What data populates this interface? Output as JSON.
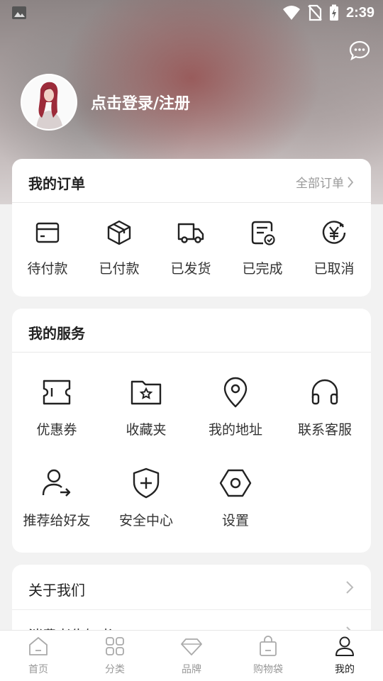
{
  "status_bar": {
    "time": "2:39"
  },
  "profile": {
    "login_label": "点击登录/注册"
  },
  "orders": {
    "title": "我的订单",
    "all_label": "全部订单",
    "items": [
      {
        "label": "待付款",
        "icon": "wallet-card-icon"
      },
      {
        "label": "已付款",
        "icon": "package-box-icon"
      },
      {
        "label": "已发货",
        "icon": "delivery-truck-icon"
      },
      {
        "label": "已完成",
        "icon": "completed-order-icon"
      },
      {
        "label": "已取消",
        "icon": "cancel-yen-icon"
      }
    ]
  },
  "services": {
    "title": "我的服务",
    "items": [
      {
        "label": "优惠券",
        "icon": "coupon-ticket-icon"
      },
      {
        "label": "收藏夹",
        "icon": "star-folder-icon"
      },
      {
        "label": "我的地址",
        "icon": "location-pin-icon"
      },
      {
        "label": "联系客服",
        "icon": "headphones-icon"
      },
      {
        "label": "推荐给好友",
        "icon": "share-user-icon"
      },
      {
        "label": "安全中心",
        "icon": "shield-plus-icon"
      },
      {
        "label": "设置",
        "icon": "hexagon-gear-icon"
      }
    ]
  },
  "about": {
    "rows": [
      {
        "label": "关于我们"
      },
      {
        "label": "消费者告知书"
      }
    ]
  },
  "tabbar": {
    "active_index": 4,
    "items": [
      {
        "label": "首页",
        "icon": "home-icon"
      },
      {
        "label": "分类",
        "icon": "category-grid-icon"
      },
      {
        "label": "品牌",
        "icon": "diamond-icon"
      },
      {
        "label": "购物袋",
        "icon": "shopping-bag-icon"
      },
      {
        "label": "我的",
        "icon": "profile-user-icon"
      }
    ]
  },
  "colors": {
    "accent": "#222222",
    "inactive": "#999999"
  }
}
